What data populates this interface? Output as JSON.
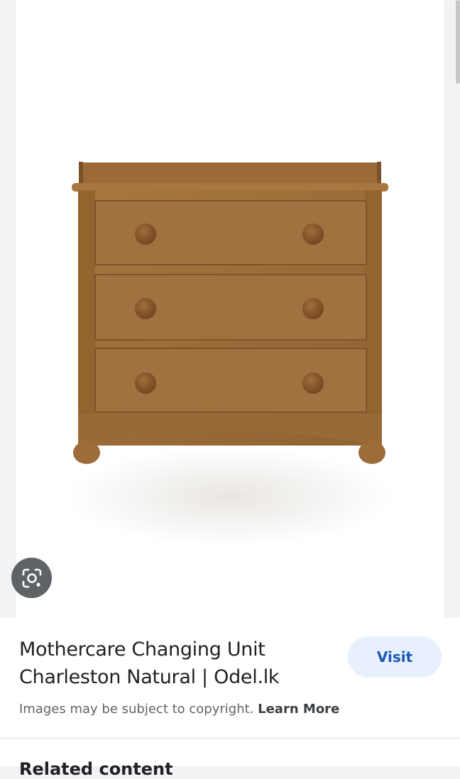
{
  "result": {
    "title_line1": "Mothercare Changing Unit",
    "title_line2": "Charleston Natural | Odel.lk",
    "visit_label": "Visit",
    "copyright_text": "Images may be subject to copyright.",
    "learn_more_label": "Learn More"
  },
  "related": {
    "heading": "Related content"
  },
  "icons": {
    "lens": "google-lens-icon"
  },
  "colors": {
    "wood": "#9c6d3a",
    "visit_bg": "#e8f0fe",
    "visit_text": "#1a57b6",
    "lens_bg": "#5f6368"
  }
}
